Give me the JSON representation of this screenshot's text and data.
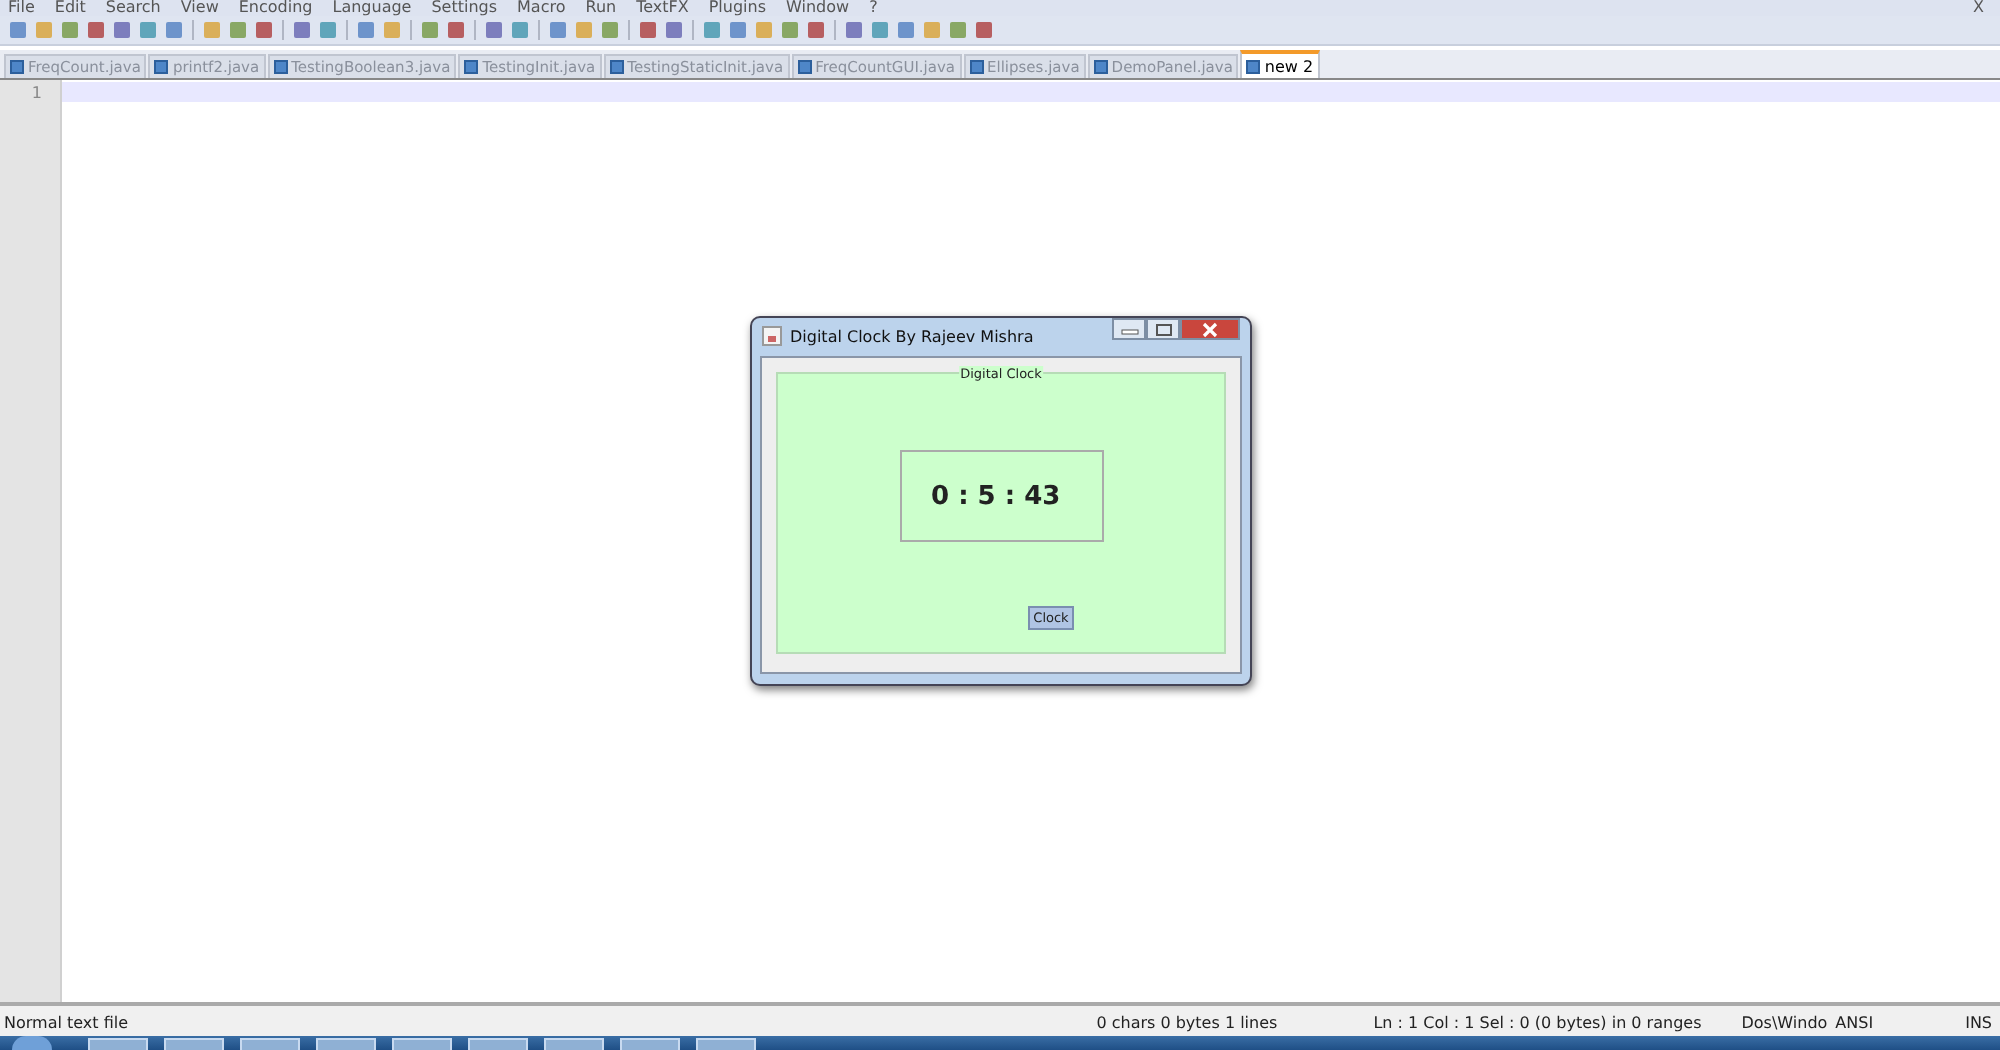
{
  "menu_bar": {
    "items": [
      "File",
      "Edit",
      "Search",
      "View",
      "Encoding",
      "Language",
      "Settings",
      "Macro",
      "Run",
      "TextFX",
      "Plugins",
      "Window",
      "?"
    ],
    "close": "X"
  },
  "tabs": [
    {
      "label": "FreqCount.java",
      "selected": false
    },
    {
      "label": "printf2.java",
      "selected": false
    },
    {
      "label": "TestingBoolean3.java",
      "selected": false
    },
    {
      "label": "TestingInit.java",
      "selected": false
    },
    {
      "label": "TestingStaticInit.java",
      "selected": false
    },
    {
      "label": "FreqCountGUI.java",
      "selected": false
    },
    {
      "label": "Ellipses.java",
      "selected": false
    },
    {
      "label": "DemoPanel.java",
      "selected": false
    },
    {
      "label": "new 2",
      "selected": true
    }
  ],
  "editor": {
    "line_numbers": [
      "1"
    ]
  },
  "dialog": {
    "title": "Digital Clock By Rajeev Mishra",
    "panel_title": "Digital Clock",
    "time": "0 : 5 : 43",
    "button": "Clock"
  },
  "status_bar": {
    "file_type": "Normal text file",
    "size": "0 chars   0 bytes   1 lines",
    "position": "Ln : 1    Col : 1    Sel : 0 (0 bytes) in 0 ranges",
    "line_ending": "Dos\\Windo",
    "encoding": "ANSI",
    "mode": "INS"
  }
}
